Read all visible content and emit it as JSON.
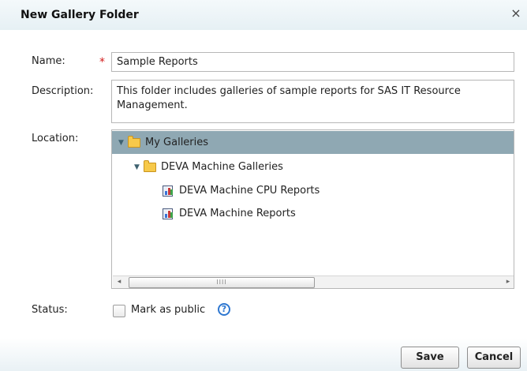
{
  "dialog": {
    "title": "New Gallery Folder",
    "close_glyph": "×"
  },
  "form": {
    "name_label": "Name:",
    "required_marker": "*",
    "name_value": "Sample Reports",
    "description_label": "Description:",
    "description_value": "This folder includes galleries of sample reports for SAS IT Resource Management.",
    "location_label": "Location:",
    "status_label": "Status:",
    "public_label": "Mark as public",
    "public_checked": false,
    "help_glyph": "?"
  },
  "tree": {
    "items": [
      {
        "label": "My Galleries",
        "type": "folder",
        "expanded": true,
        "selected": true,
        "depth": 0
      },
      {
        "label": "DEVA Machine Galleries",
        "type": "folder",
        "expanded": true,
        "selected": false,
        "depth": 1
      },
      {
        "label": "DEVA Machine CPU Reports",
        "type": "gallery",
        "selected": false,
        "depth": 2
      },
      {
        "label": "DEVA Machine Reports",
        "type": "gallery",
        "selected": false,
        "depth": 2
      }
    ],
    "scroll_left_glyph": "◂",
    "scroll_right_glyph": "▸",
    "scroll_grip": "IIII"
  },
  "buttons": {
    "save": "Save",
    "cancel": "Cancel"
  },
  "colors": {
    "selected_row": "#8fa8b3",
    "required": "#d21a1a",
    "help_accent": "#2e77d0"
  },
  "icons": {
    "folder": "folder-icon",
    "gallery": "report-gallery-icon",
    "expand": "triangle-down-icon",
    "help": "help-icon",
    "close": "close-icon"
  }
}
